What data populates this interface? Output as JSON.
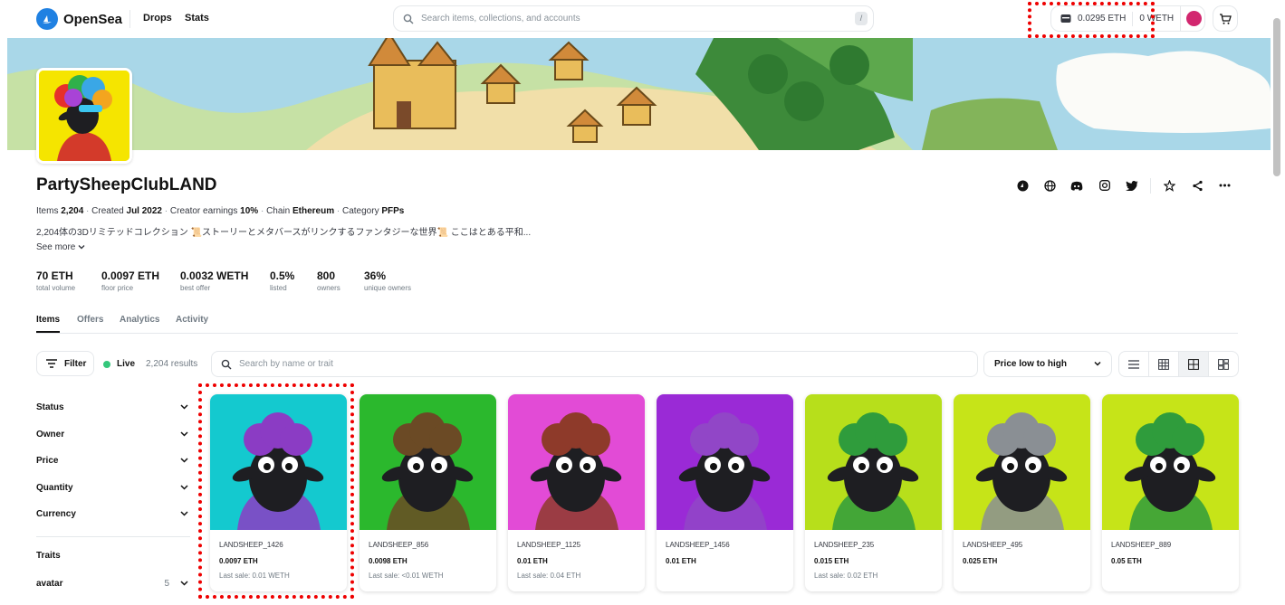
{
  "header": {
    "brand": "OpenSea",
    "nav": [
      "Drops",
      "Stats"
    ],
    "search_placeholder": "Search items, collections, and accounts",
    "search_shortcut": "/",
    "wallet_eth": "0.0295 ETH",
    "wallet_weth": "0 WETH",
    "accent": "#2081e2"
  },
  "collection": {
    "title": "PartySheepClubLAND",
    "items_label": "Items",
    "items_value": "2,204",
    "created_label": "Created",
    "created_value": "Jul 2022",
    "earnings_label": "Creator earnings",
    "earnings_value": "10%",
    "chain_label": "Chain",
    "chain_value": "Ethereum",
    "category_label": "Category",
    "category_value": "PFPs",
    "description": "2,204体の3Dリミテッドコレクション 📜ストーリーとメタバースがリンクするファンタジーな世界📜 ここはとある平和...",
    "see_more": "See more",
    "stats": [
      {
        "value": "70 ETH",
        "label": "total volume"
      },
      {
        "value": "0.0097 ETH",
        "label": "floor price"
      },
      {
        "value": "0.0032 WETH",
        "label": "best offer"
      },
      {
        "value": "0.5%",
        "label": "listed"
      },
      {
        "value": "800",
        "label": "owners"
      },
      {
        "value": "36%",
        "label": "unique owners"
      }
    ]
  },
  "tabs": [
    "Items",
    "Offers",
    "Analytics",
    "Activity"
  ],
  "toolbar": {
    "filter_label": "Filter",
    "live_label": "Live",
    "results": "2,204 results",
    "search_placeholder": "Search by name or trait",
    "sort_label": "Price low to high"
  },
  "sidebar": {
    "filters": [
      "Status",
      "Owner",
      "Price",
      "Quantity",
      "Currency"
    ],
    "traits_label": "Traits",
    "trait_first": {
      "name": "avatar",
      "count": "5"
    }
  },
  "cards": [
    {
      "name": "LANDSHEEP_1426",
      "price": "0.0097 ETH",
      "last_sale": "Last sale: 0.01 WETH",
      "bg": "#14c9cf",
      "hair": "#8b3cc4"
    },
    {
      "name": "LANDSHEEP_856",
      "price": "0.0098 ETH",
      "last_sale": "Last sale: <0.01 WETH",
      "bg": "#2bb82d",
      "hair": "#6b4a25"
    },
    {
      "name": "LANDSHEEP_1125",
      "price": "0.01 ETH",
      "last_sale": "Last sale: 0.04 ETH",
      "bg": "#e24bd6",
      "hair": "#8e3a2a"
    },
    {
      "name": "LANDSHEEP_1456",
      "price": "0.01 ETH",
      "last_sale": "",
      "bg": "#9a2ad6",
      "hair": "#9146c7"
    },
    {
      "name": "LANDSHEEP_235",
      "price": "0.015 ETH",
      "last_sale": "Last sale: 0.02 ETH",
      "bg": "#b7df1b",
      "hair": "#2f9c3c"
    },
    {
      "name": "LANDSHEEP_495",
      "price": "0.025 ETH",
      "last_sale": "",
      "bg": "#c6e418",
      "hair": "#8a8f94"
    },
    {
      "name": "LANDSHEEP_889",
      "price": "0.05 ETH",
      "last_sale": "",
      "bg": "#c6e418",
      "hair": "#2f9c3c"
    }
  ]
}
